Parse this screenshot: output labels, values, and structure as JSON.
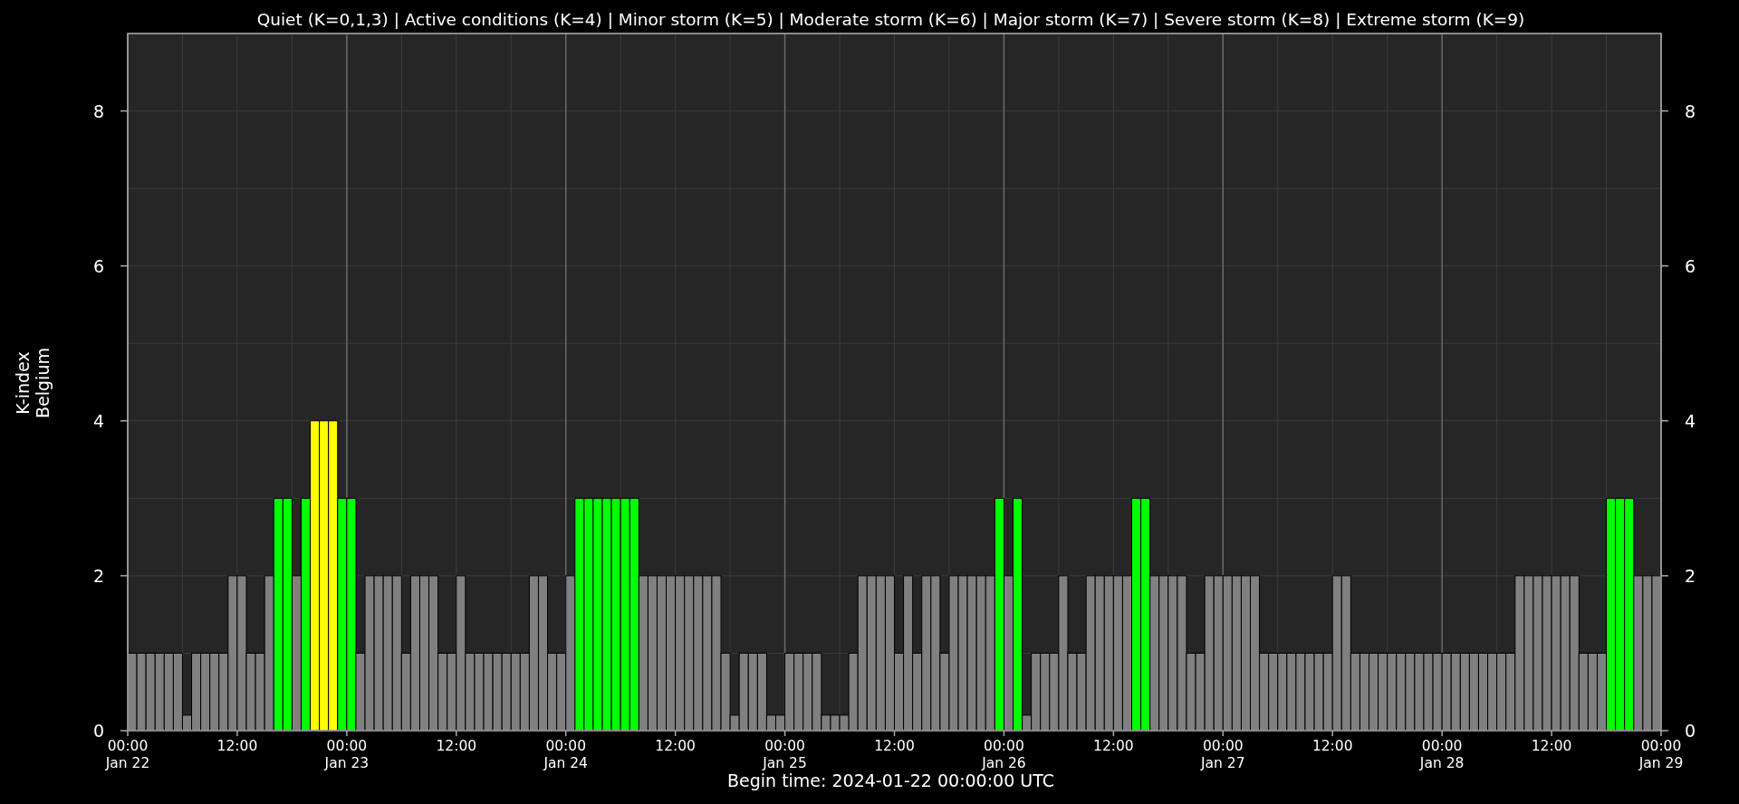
{
  "chart_data": {
    "type": "bar",
    "stacked": true,
    "grid": true,
    "title": "Quiet (K=0,1,3) | Active conditions (K=4) | Minor storm (K=5) | Moderate storm (K=6) | Major storm (K=7) | Severe storm (K=8) | Extreme storm (K=9)",
    "xlabel": "Begin time: 2024-01-22 00:00:00 UTC",
    "ylabel": "K-index\nBelgium",
    "categories": [
      "00:00\nJan 22",
      null,
      null,
      null,
      null,
      null,
      null,
      null,
      null,
      null,
      null,
      null,
      "12:00",
      null,
      null,
      null,
      null,
      null,
      null,
      null,
      null,
      null,
      null,
      null,
      "00:00\nJan 23",
      null,
      null,
      null,
      null,
      null,
      null,
      null,
      null,
      null,
      null,
      null,
      "12:00",
      null,
      null,
      null,
      null,
      null,
      null,
      null,
      null,
      null,
      null,
      null,
      "00:00\nJan 24",
      null,
      null,
      null,
      null,
      null,
      null,
      null,
      null,
      null,
      null,
      null,
      "12:00",
      null,
      null,
      null,
      null,
      null,
      null,
      null,
      null,
      null,
      null,
      null,
      "00:00\nJan 25",
      null,
      null,
      null,
      null,
      null,
      null,
      null,
      null,
      null,
      null,
      null,
      "12:00",
      null,
      null,
      null,
      null,
      null,
      null,
      null,
      null,
      null,
      null,
      null,
      "00:00\nJan 26",
      null,
      null,
      null,
      null,
      null,
      null,
      null,
      null,
      null,
      null,
      null,
      "12:00",
      null,
      null,
      null,
      null,
      null,
      null,
      null,
      null,
      null,
      null,
      null,
      "00:00\nJan 27",
      null,
      null,
      null,
      null,
      null,
      null,
      null,
      null,
      null,
      null,
      null,
      "12:00",
      null,
      null,
      null,
      null,
      null,
      null,
      null,
      null,
      null,
      null,
      null,
      "00:00\nJan 28",
      null,
      null,
      null,
      null,
      null,
      null,
      null,
      null,
      null,
      null,
      null,
      "12:00",
      null,
      null,
      null,
      null,
      null,
      null,
      null,
      null,
      null,
      null,
      null
    ],
    "ylim": [
      0,
      9
    ],
    "yticks": [
      0,
      2,
      4,
      6,
      8
    ],
    "series": [
      {
        "color": "#808080",
        "values": [
          1,
          1,
          1,
          1,
          1,
          1,
          0.2,
          1,
          1,
          1,
          1,
          2,
          2,
          1,
          1,
          2,
          null,
          null,
          2,
          null,
          null,
          null,
          null,
          null,
          null,
          1,
          2,
          2,
          2,
          2,
          1,
          2,
          2,
          2,
          1,
          1,
          2,
          1,
          1,
          1,
          1,
          1,
          1,
          1,
          2,
          2,
          1,
          1,
          2,
          null,
          null,
          null,
          null,
          null,
          null,
          null,
          2,
          2,
          2,
          2,
          2,
          2,
          2,
          2,
          2,
          1,
          0.2,
          1,
          1,
          1,
          0.2,
          0.2,
          1,
          1,
          1,
          1,
          0.2,
          0.2,
          0.2,
          1,
          2,
          2,
          2,
          2,
          1,
          2,
          1,
          2,
          2,
          1,
          2,
          2,
          2,
          2,
          2,
          null,
          2,
          null,
          0.2,
          1,
          1,
          1,
          2,
          1,
          1,
          2,
          2,
          2,
          2,
          2,
          null,
          null,
          2,
          2,
          2,
          2,
          1,
          1,
          2,
          2,
          2,
          2,
          2,
          2,
          1,
          1,
          1,
          1,
          1,
          1,
          1,
          1,
          2,
          2,
          1,
          1,
          1,
          1,
          1,
          1,
          1,
          1,
          1,
          1,
          1,
          1,
          1,
          1,
          1,
          1,
          1,
          1,
          2,
          2,
          2,
          2,
          2,
          2,
          2,
          1,
          1,
          1,
          null,
          null,
          null,
          2,
          2,
          2
        ]
      },
      {
        "color": "#00ff00",
        "values": [
          null,
          null,
          null,
          null,
          null,
          null,
          null,
          null,
          null,
          null,
          null,
          null,
          null,
          null,
          null,
          null,
          3,
          3,
          null,
          3,
          null,
          null,
          null,
          3,
          3,
          null,
          null,
          null,
          null,
          null,
          null,
          null,
          null,
          null,
          null,
          null,
          null,
          null,
          null,
          null,
          null,
          null,
          null,
          null,
          null,
          null,
          null,
          null,
          null,
          3,
          3,
          3,
          3,
          3,
          3,
          3,
          null,
          null,
          null,
          null,
          null,
          null,
          null,
          null,
          null,
          null,
          null,
          null,
          null,
          null,
          null,
          null,
          null,
          null,
          null,
          null,
          null,
          null,
          null,
          null,
          null,
          null,
          null,
          null,
          null,
          null,
          null,
          null,
          null,
          null,
          null,
          null,
          null,
          null,
          null,
          3,
          null,
          3,
          null,
          null,
          null,
          null,
          null,
          null,
          null,
          null,
          null,
          null,
          null,
          null,
          3,
          3,
          null,
          null,
          null,
          null,
          null,
          null,
          null,
          null,
          null,
          null,
          null,
          null,
          null,
          null,
          null,
          null,
          null,
          null,
          null,
          null,
          null,
          null,
          null,
          null,
          null,
          null,
          null,
          null,
          null,
          null,
          null,
          null,
          null,
          null,
          null,
          null,
          null,
          null,
          null,
          null,
          null,
          null,
          null,
          null,
          null,
          null,
          null,
          null,
          null,
          null,
          3,
          3,
          3,
          null,
          null,
          null
        ]
      },
      {
        "color": "#ffff00",
        "values": [
          null,
          null,
          null,
          null,
          null,
          null,
          null,
          null,
          null,
          null,
          null,
          null,
          null,
          null,
          null,
          null,
          null,
          null,
          null,
          null,
          4,
          4,
          4,
          null,
          null,
          null,
          null,
          null,
          null,
          null,
          null,
          null,
          null,
          null,
          null,
          null,
          null,
          null,
          null,
          null,
          null,
          null,
          null,
          null,
          null,
          null,
          null,
          null,
          null,
          null,
          null,
          null,
          null,
          null,
          null,
          null,
          null,
          null,
          null,
          null,
          null,
          null,
          null,
          null,
          null,
          null,
          null,
          null,
          null,
          null,
          null,
          null,
          null,
          null,
          null,
          null,
          null,
          null,
          null,
          null,
          null,
          null,
          null,
          null,
          null,
          null,
          null,
          null,
          null,
          null,
          null,
          null,
          null,
          null,
          null,
          null,
          null,
          null,
          null,
          null,
          null,
          null,
          null,
          null,
          null,
          null,
          null,
          null,
          null,
          null,
          null,
          null,
          null,
          null,
          null,
          null,
          null,
          null,
          null,
          null,
          null,
          null,
          null,
          null,
          null,
          null,
          null,
          null,
          null,
          null,
          null,
          null,
          null,
          null,
          null,
          null,
          null,
          null,
          null,
          null,
          null,
          null,
          null,
          null,
          null,
          null,
          null,
          null,
          null,
          null,
          null,
          null,
          null,
          null,
          null,
          null,
          null,
          null,
          null,
          null,
          null,
          null,
          null,
          null,
          null,
          null,
          null,
          null
        ]
      }
    ]
  },
  "x_axis_end": {
    "label": "00:00\nJan 29"
  },
  "right_axis": {
    "ticks": [
      "8",
      "6",
      "4",
      "2",
      "0"
    ]
  }
}
